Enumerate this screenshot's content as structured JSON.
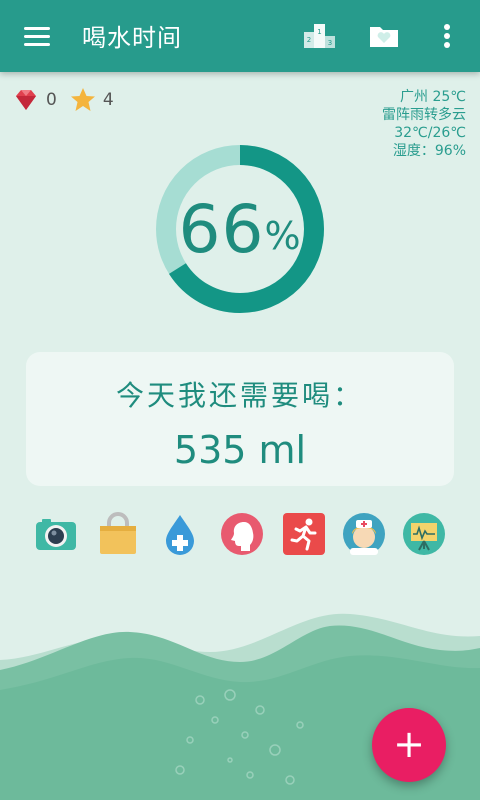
{
  "appbar": {
    "title": "喝水时间",
    "menu_icon": "hamburger-menu-icon",
    "actions": [
      "ranking-podium-icon",
      "folder-heart-icon",
      "more-vert-icon"
    ]
  },
  "stats": {
    "gems": "0",
    "stars": "4",
    "gem_icon": "ruby-gem-icon",
    "star_icon": "star-icon"
  },
  "weather": {
    "city_temp": "广州 25℃",
    "condition": "雷阵雨转多云",
    "range": "32℃/26℃",
    "humidity": "湿度：96%"
  },
  "progress": {
    "value": "66",
    "unit": "%",
    "fraction": 0.66
  },
  "remaining": {
    "label": "今天我还需要喝：",
    "amount": "535 ml"
  },
  "tools": [
    "camera-icon",
    "shopping-bag-icon",
    "water-drop-plus-icon",
    "woman-profile-icon",
    "running-man-icon",
    "nurse-icon",
    "presentation-chart-icon"
  ],
  "fab": {
    "label": "+"
  },
  "colors": {
    "primary": "#279b8c",
    "progress_fg": "#139686",
    "progress_bg": "#a6ddd3",
    "accent": "#e91e63",
    "background": "#dff0ea"
  }
}
